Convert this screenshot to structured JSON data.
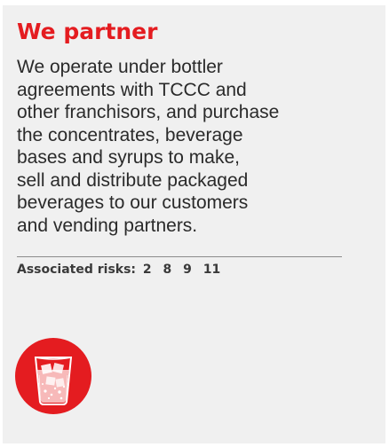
{
  "card": {
    "title": "We partner",
    "body_lines": [
      "We operate under bottler",
      "agreements with TCCC and",
      "other franchisors, and purchase",
      "the concentrates, beverage",
      "bases and syrups to make,",
      "sell and distribute packaged",
      "beverages to our customers",
      "and vending partners."
    ],
    "risks_label": "Associated risks:",
    "risks": [
      "2",
      "8",
      "9",
      "11"
    ],
    "icon": "glass-with-ice-icon"
  },
  "colors": {
    "accent": "#e41c20",
    "background": "#f0f0f0",
    "text": "#2a2a2a"
  }
}
